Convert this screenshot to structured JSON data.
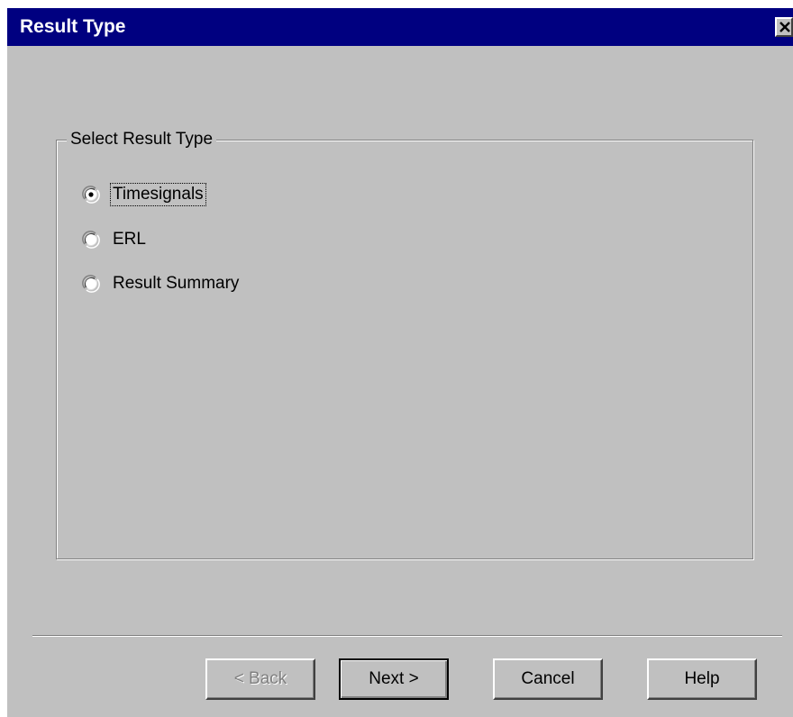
{
  "window": {
    "title": "Result Type"
  },
  "group": {
    "label": "Select Result Type",
    "options": [
      {
        "label": "Timesignals",
        "selected": true
      },
      {
        "label": "ERL",
        "selected": false
      },
      {
        "label": "Result Summary",
        "selected": false
      }
    ]
  },
  "buttons": {
    "back": "< Back",
    "next": "Next >",
    "cancel": "Cancel",
    "help": "Help"
  },
  "icons": {
    "close": "close-icon"
  },
  "colors": {
    "titlebar": "#000080",
    "face": "#c0c0c0"
  }
}
